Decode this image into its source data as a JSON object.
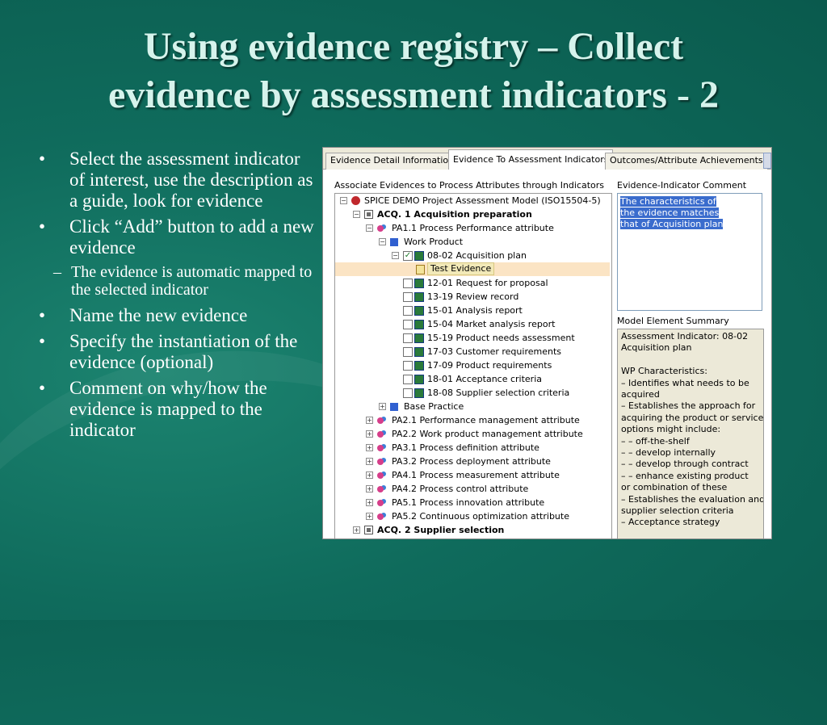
{
  "slide": {
    "title_line1": "Using evidence registry – Collect",
    "title_line2": "evidence by assessment indicators - 2",
    "bullets": [
      "Select the assessment indicator of interest, use the description as a guide, look for evidence",
      "Click “Add” button to add a new evidence",
      "The evidence is automatic mapped to the selected indicator",
      "Name the new evidence",
      "Specify the instantiation of the evidence (optional)",
      "Comment on why/how the evidence is mapped to the indicator"
    ]
  },
  "app": {
    "tabs": [
      "Evidence Detail Information",
      "Evidence To Assessment Indicators",
      "Outcomes/Attribute Achievements I"
    ],
    "assoc_label": "Associate Evidences to Process Attributes through Indicators",
    "comment_label": "Evidence-Indicator Comment",
    "comment_text": "The characteristics of the evidence matches that of Acquisition plan",
    "summary_label": "Model Element Summary",
    "tree": [
      "SPICE DEMO Project Assessment Model (ISO15504-5)",
      "ACQ. 1 Acquisition preparation",
      "PA1.1 Process Performance attribute",
      "Work Product",
      "08-02 Acquisition plan",
      "Test Evidence",
      "12-01 Request for proposal",
      "13-19 Review record",
      "15-01 Analysis report",
      "15-04 Market analysis report",
      "15-19 Product needs assessment",
      "17-03 Customer requirements",
      "17-09 Product requirements",
      "18-01 Acceptance criteria",
      "18-08 Supplier selection criteria",
      "Base Practice",
      "PA2.1 Performance management attribute",
      "PA2.2 Work product management attribute",
      "PA3.1 Process definition attribute",
      "PA3.2 Process deployment attribute",
      "PA4.1 Process measurement attribute",
      "PA4.2 Process control attribute",
      "PA5.1 Process innovation attribute",
      "PA5.2 Continuous optimization attribute",
      "ACQ. 2 Supplier selection"
    ],
    "summary_lines": [
      "Assessment Indicator: 08-02",
      "Acquisition plan",
      "",
      "WP Characteristics:",
      "– Identifies what needs to be",
      "acquired",
      "– Establishes the approach for",
      "acquiring the product or service;",
      "options might include:",
      "– – off-the-shelf",
      "– – develop internally",
      "– – develop through contract",
      "– – enhance existing product",
      "or combination of these",
      "– Establishes the evaluation and",
      "supplier selection criteria",
      "– Acceptance strategy"
    ]
  },
  "colors": {
    "background": "#0f6b5c",
    "title": "#d6f3ec",
    "selection": "#3a6ccd",
    "selected_row": "#fbe4c4"
  }
}
